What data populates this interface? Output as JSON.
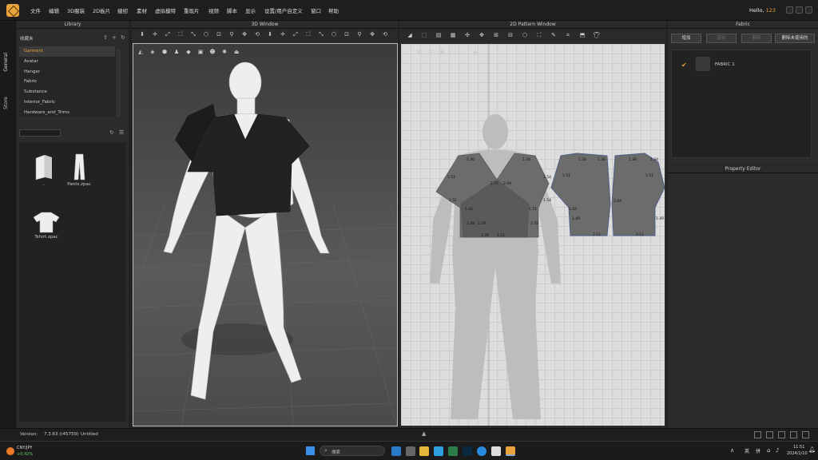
{
  "app": {
    "user_greeting": "Hello,",
    "username": "123"
  },
  "menu": [
    "文件",
    "编辑",
    "3D服装",
    "2D板片",
    "缝纫",
    "素材",
    "虚拟模特",
    "重现片",
    "视频",
    "脚本",
    "显示",
    "设置/用户自定义",
    "窗口",
    "帮助"
  ],
  "side_tabs": [
    "General",
    "Store"
  ],
  "library": {
    "title": "Library",
    "header": "收藏夹",
    "items": [
      "Garment",
      "Avatar",
      "Hanger",
      "Fabric",
      "Substance",
      "Interior_Fabric",
      "Hardware_and_Trims"
    ],
    "selected": "Garment",
    "files": [
      {
        "label": "..",
        "icon": "folder-icon"
      },
      {
        "label": "Pants.zpac",
        "icon": "pants-icon"
      },
      {
        "label": "Tshirt.zpac",
        "icon": "tshirt-icon"
      }
    ]
  },
  "window3d": {
    "title": "3D Window"
  },
  "window2d": {
    "title": "2D Pattern Window",
    "measurements": [
      "1.36",
      "1.34",
      "1.51",
      "1.54",
      "1.51",
      "1.54",
      "2.70",
      "2.94",
      "1.51",
      "1.42",
      "2.28",
      "2.28",
      "2.35",
      "2.12",
      "2.28",
      "1.34",
      "1.36",
      "1.36",
      "1.34",
      "1.51",
      "1.51",
      "1.42",
      "1.49",
      "2.12",
      "2.12",
      "2.84",
      "1.49"
    ]
  },
  "fabric": {
    "title": "Fabric",
    "buttons": [
      "增加",
      "复制",
      "删除",
      "删除未使用的"
    ],
    "items": [
      {
        "name": "FABRIC 1"
      }
    ]
  },
  "property_editor": {
    "title": "Property Editor"
  },
  "status": {
    "version_label": "Version:",
    "version": "7.3.63 (r45759)",
    "file": "Untitled"
  },
  "taskbar": {
    "weather_pair": "CNY/JPY",
    "weather_change": "+0.42%",
    "search": "搜索",
    "ime": [
      "英",
      "拼"
    ],
    "time": "11:51",
    "date": "2024/1/10"
  },
  "colors": {
    "accent": "#e8a33a",
    "panel": "#2b2b2b",
    "viewport2d": "#dddddd"
  }
}
